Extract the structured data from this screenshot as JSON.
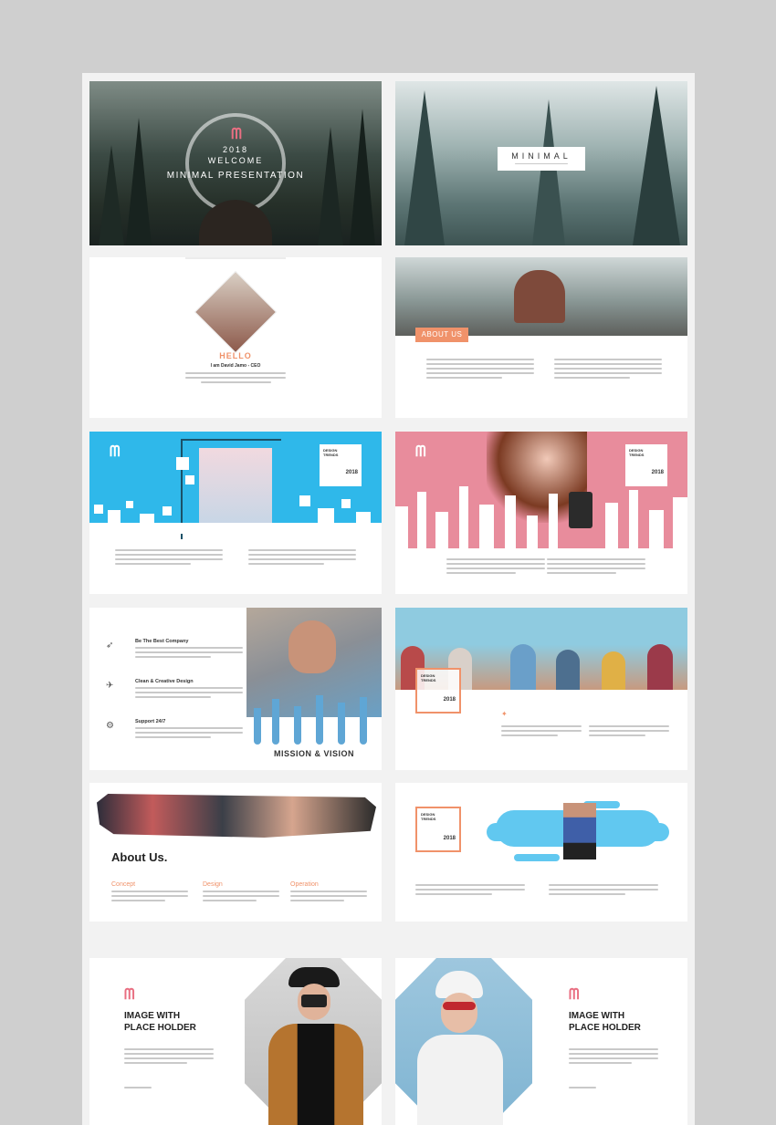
{
  "slide1": {
    "year": "2018",
    "welcome": "WELCOME",
    "title": "MINIMAL PRESENTATION"
  },
  "slide2": {
    "title": "MINIMAL"
  },
  "slide3": {
    "heading": "HELLO",
    "name": "I am David Jamo - CEO"
  },
  "slide4": {
    "badge": "ABOUT US"
  },
  "slide5": {
    "design": "DESIGN",
    "trends": "TRENDS",
    "year": "2018"
  },
  "slide6": {
    "design": "DESIGN",
    "trends": "TRENDS",
    "year": "2018"
  },
  "slide7": {
    "items": [
      {
        "title": "Be The Best Company"
      },
      {
        "title": "Clean & Creative Design"
      },
      {
        "title": "Support 24/7"
      }
    ],
    "caption": "MISSION & VISION"
  },
  "slide8": {
    "design": "DESIGN",
    "trends": "TRENDS",
    "year": "2018"
  },
  "slide9": {
    "title": "About Us.",
    "cols": [
      "Concept",
      "Design",
      "Operation"
    ]
  },
  "slide10": {
    "design": "DESIGN",
    "trends": "TRENDS",
    "year": "2018"
  },
  "slide11": {
    "line1": "IMAGE WITH",
    "line2": "PLACE HOLDER"
  },
  "slide12": {
    "line1": "IMAGE WITH",
    "line2": "PLACE HOLDER"
  },
  "colors": {
    "accent": "#f0926a",
    "blue": "#2fb8ea",
    "pink": "#e88c9c",
    "sky": "#61c8f0"
  }
}
